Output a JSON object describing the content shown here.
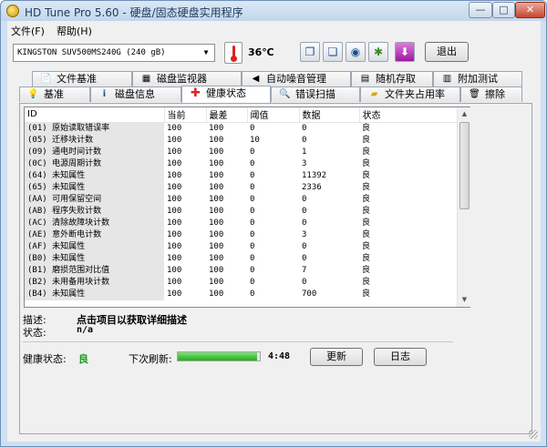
{
  "window": {
    "title": "HD Tune Pro 5.60 - 硬盘/固态硬盘实用程序"
  },
  "menu": [
    {
      "label": "文件(F)"
    },
    {
      "label": "帮助(H)"
    }
  ],
  "toolbar": {
    "drive": "KINGSTON SUV500MS240G (240 gB)",
    "temperature": "36℃",
    "exit_label": "退出"
  },
  "tabs_row1": [
    {
      "label": "文件基准",
      "icon": "file-benchmark-icon"
    },
    {
      "label": "磁盘监视器",
      "icon": "disk-monitor-icon"
    },
    {
      "label": "自动噪音管理",
      "icon": "speaker-icon"
    },
    {
      "label": "随机存取",
      "icon": "random-access-icon"
    },
    {
      "label": "附加测试",
      "icon": "extra-tests-icon"
    }
  ],
  "tabs_row2": [
    {
      "label": "基准",
      "icon": "benchmark-icon"
    },
    {
      "label": "磁盘信息",
      "icon": "info-icon"
    },
    {
      "label": "健康状态",
      "icon": "health-icon",
      "active": true
    },
    {
      "label": "错误扫描",
      "icon": "error-scan-icon"
    },
    {
      "label": "文件夹占用率",
      "icon": "folder-icon"
    },
    {
      "label": "擦除",
      "icon": "erase-icon"
    }
  ],
  "table": {
    "headers": [
      "ID",
      "当前",
      "最差",
      "阈值",
      "数据",
      "状态"
    ],
    "rows": [
      [
        "(01) 原始读取错误率",
        "100",
        "100",
        "0",
        "0",
        "良"
      ],
      [
        "(05) 迁移块计数",
        "100",
        "100",
        "10",
        "0",
        "良"
      ],
      [
        "(09) 通电时间计数",
        "100",
        "100",
        "0",
        "1",
        "良"
      ],
      [
        "(0C) 电源周期计数",
        "100",
        "100",
        "0",
        "3",
        "良"
      ],
      [
        "(64) 未知属性",
        "100",
        "100",
        "0",
        "11392",
        "良"
      ],
      [
        "(65) 未知属性",
        "100",
        "100",
        "0",
        "2336",
        "良"
      ],
      [
        "(AA) 可用保留空间",
        "100",
        "100",
        "0",
        "0",
        "良"
      ],
      [
        "(AB) 程序失败计数",
        "100",
        "100",
        "0",
        "0",
        "良"
      ],
      [
        "(AC) 清除故障块计数",
        "100",
        "100",
        "0",
        "0",
        "良"
      ],
      [
        "(AE) 意外断电计数",
        "100",
        "100",
        "0",
        "3",
        "良"
      ],
      [
        "(AF) 未知属性",
        "100",
        "100",
        "0",
        "0",
        "良"
      ],
      [
        "(B0) 未知属性",
        "100",
        "100",
        "0",
        "0",
        "良"
      ],
      [
        "(B1) 磨损范围对比值",
        "100",
        "100",
        "0",
        "7",
        "良"
      ],
      [
        "(B2) 未用备用块计数",
        "100",
        "100",
        "0",
        "0",
        "良"
      ],
      [
        "(B4) 未知属性",
        "100",
        "100",
        "0",
        "700",
        "良"
      ]
    ]
  },
  "details": {
    "desc_label": "描述:",
    "desc_value": "点击项目以获取详细描述",
    "state_label": "状态:",
    "state_value": "n/a"
  },
  "footer": {
    "health_label": "健康状态:",
    "health_value": "良",
    "refresh_label": "下次刷新:",
    "refresh_progress": 0.97,
    "refresh_time": "4:48",
    "update_label": "更新",
    "log_label": "日志"
  },
  "colors": {
    "health_good": "#1a9b1a",
    "accent": "#1f4f8f"
  }
}
